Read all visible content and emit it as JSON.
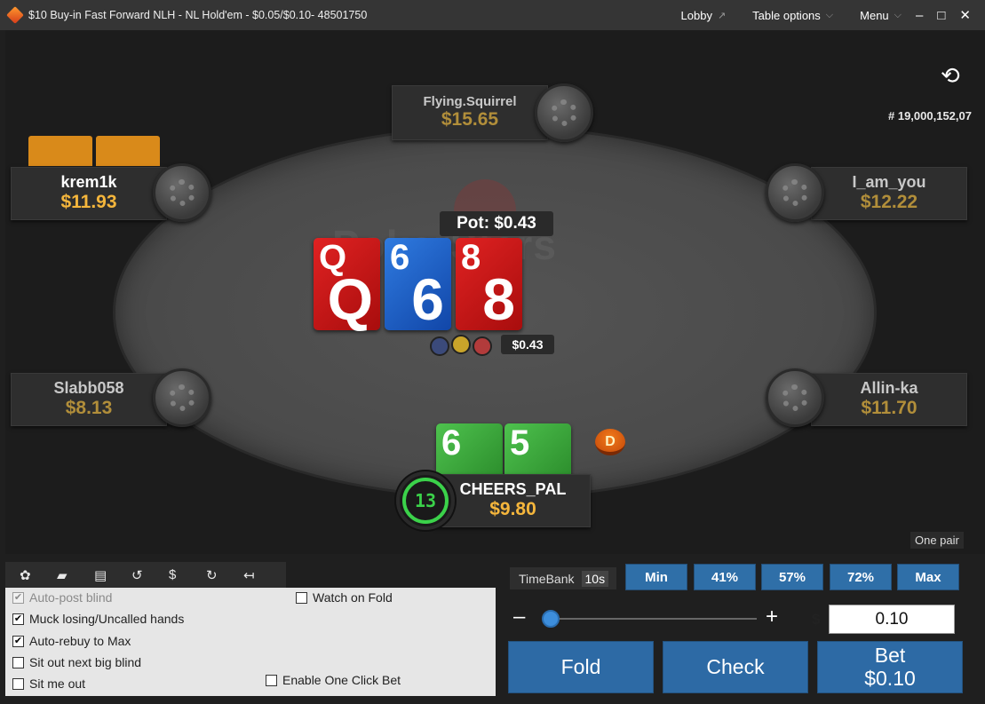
{
  "titlebar": {
    "title": "$10 Buy-in Fast Forward NLH -  NL  Hold'em - $0.05/$0.10- 48501750",
    "lobby": "Lobby",
    "lobby_icon": "↗",
    "table_options": "Table options",
    "menu": "Menu",
    "chevron": "⌵",
    "minimize": "–",
    "maximize": "□",
    "close": "✕"
  },
  "table": {
    "hand_id": "# 19,000,152,07",
    "refresh_icon": "⟲",
    "watermark": "PokerStars",
    "hand_rank": "One pair",
    "pot_label": "Pot: $0.43",
    "bet_amount": "$0.43",
    "dealer_button": "D"
  },
  "seats": [
    {
      "name": "Flying.Squirrel",
      "stack": "$15.65",
      "dimmed": true
    },
    {
      "name": "krem1k",
      "stack": "$11.93",
      "dimmed": false
    },
    {
      "name": "I_am_you",
      "stack": "$12.22",
      "dimmed": true
    },
    {
      "name": "Slabb058",
      "stack": "$8.13",
      "dimmed": true
    },
    {
      "name": "Allin-ka",
      "stack": "$11.70",
      "dimmed": true
    },
    {
      "name": "CHEERS_PAL",
      "stack": "$9.80",
      "dimmed": false
    }
  ],
  "board": [
    {
      "rank": "Q",
      "color": "red"
    },
    {
      "rank": "6",
      "color": "blue"
    },
    {
      "rank": "8",
      "color": "red"
    }
  ],
  "hero_cards": [
    {
      "rank": "6",
      "color": "green"
    },
    {
      "rank": "5",
      "color": "green"
    }
  ],
  "timer": "13",
  "toolbar_icons": [
    "gear-icon",
    "chat-icon",
    "notes-icon",
    "rebuy-icon",
    "cashier-icon",
    "replay-icon",
    "collapse-icon"
  ],
  "toolbar_glyphs": [
    "✿",
    "▰",
    "▤",
    "↺",
    "$",
    "↻",
    "↤"
  ],
  "options": {
    "auto_post": "Auto-post blind",
    "muck": "Muck losing/Uncalled hands",
    "auto_rebuy": "Auto-rebuy to Max",
    "sit_out_bb": "Sit out next big blind",
    "sit_me_out": "Sit me out",
    "watch_fold": "Watch on Fold",
    "one_click": "Enable One Click Bet",
    "check": "✔"
  },
  "controls": {
    "timebank_label": "TimeBank",
    "timebank_secs": "10s",
    "presets": [
      "Min",
      "41%",
      "57%",
      "72%",
      "Max"
    ],
    "minus": "–",
    "plus": "+",
    "dollar": "$",
    "bet_value": "0.10",
    "slider_level": 0,
    "fold": "Fold",
    "check": "Check",
    "bet": "Bet",
    "bet_btn_amount": "$0.10"
  }
}
